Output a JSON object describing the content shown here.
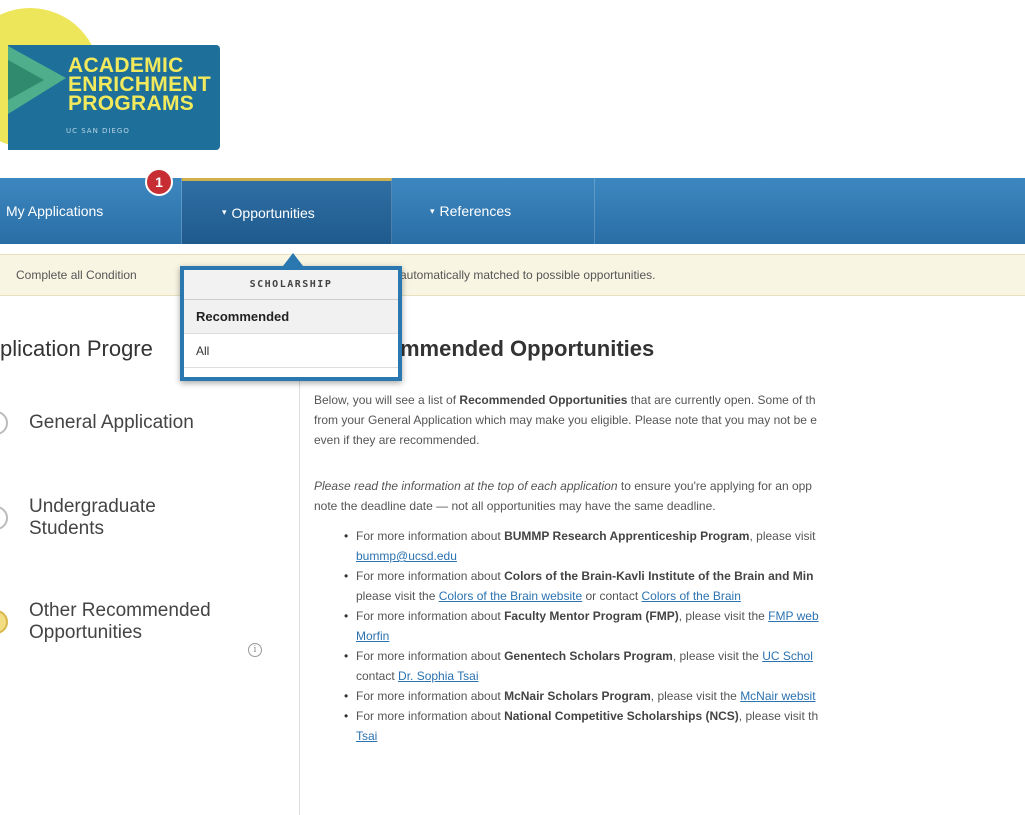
{
  "logo": {
    "line1": "ACADEMIC",
    "line2": "ENRICHMENT",
    "line3": "PROGRAMS",
    "sub": "UC SAN DIEGO",
    "icon": "triangle-logo-icon"
  },
  "nav": {
    "tabs": [
      {
        "label": "My Applications"
      },
      {
        "label": "Opportunities"
      },
      {
        "label": "References"
      }
    ],
    "badge": "1",
    "caret": "▾"
  },
  "notice": {
    "left": "Complete all Condition",
    "right": "automatically matched to possible opportunities."
  },
  "dropdown": {
    "header": "SCHOLARSHIP",
    "items": [
      "Recommended",
      "All"
    ]
  },
  "sidebar": {
    "title": "plication Progre",
    "steps": [
      {
        "line1": "General Application",
        "line2": ""
      },
      {
        "line1": "Undergraduate",
        "line2": "Students"
      },
      {
        "line1": "Other Recommended",
        "line2": "Opportunities"
      }
    ],
    "info_icon": "i"
  },
  "main": {
    "title": "mmended Opportunities",
    "p1": {
      "a": "Below, you will see a list of ",
      "b": "Recommended Opportunities",
      "c": " that are currently open. Some of th",
      "line2": "from your General Application which may make you eligible. Please note that you may not be e",
      "line3": "even if they are recommended."
    },
    "p2": {
      "a": "Please read the information at the top of each application",
      "b": " to ensure you're applying for an opp",
      "line2": "note the deadline date — not all opportunities may have the same deadline."
    },
    "bullets": [
      {
        "pre": "For more information about ",
        "bold": "BUMMP Research Apprenticeship Program",
        "post": ", please visit",
        "sub_link": "bummp@ucsd.edu",
        "sub_pre": "",
        "sub_mid": "",
        "sub_link2": ""
      },
      {
        "pre": "For more information about ",
        "bold": "Colors of the Brain-Kavli Institute of the Brain and Min",
        "post": "",
        "sub_pre": "please visit the ",
        "sub_link": "Colors of the Brain website",
        "sub_mid": " or contact ",
        "sub_link2": "Colors of the Brain"
      },
      {
        "pre": "For more information about ",
        "bold": "Faculty Mentor Program (FMP)",
        "post": ", please visit the ",
        "link": "FMP web",
        "sub_pre": "",
        "sub_link": "Morfin",
        "sub_mid": "",
        "sub_link2": ""
      },
      {
        "pre": "For more information about ",
        "bold": "Genentech Scholars Program",
        "post": ", please visit the ",
        "link": "UC Schol",
        "sub_pre": "contact ",
        "sub_link": "Dr. Sophia Tsai",
        "sub_mid": "",
        "sub_link2": ""
      },
      {
        "pre": "For more information about ",
        "bold": "McNair Scholars Program",
        "post": ", please visit the ",
        "link": "McNair websit"
      },
      {
        "pre": "For more information about ",
        "bold": "National Competitive Scholarships (NCS)",
        "post": ", please visit th",
        "sub_pre": "",
        "sub_link": "Tsai",
        "sub_mid": "",
        "sub_link2": ""
      }
    ]
  },
  "colors": {
    "nav_blue": "#2a6ea6",
    "badge_red": "#c62e33",
    "logo_yellow": "#ede55a",
    "link_blue": "#2b72b0"
  }
}
